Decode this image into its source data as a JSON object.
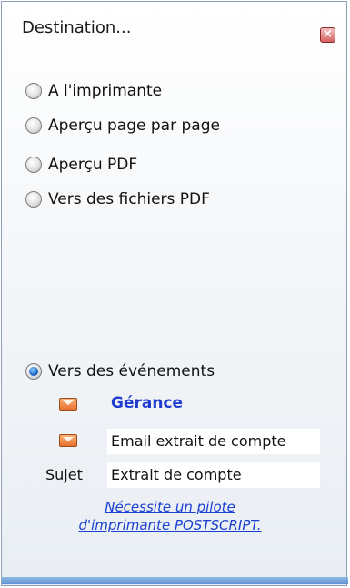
{
  "panel": {
    "title": "Destination...",
    "close_icon": "close-icon"
  },
  "options": [
    {
      "label": "A l'imprimante",
      "selected": false
    },
    {
      "label": "Aperçu page par page",
      "selected": false
    },
    {
      "label": "Aperçu PDF",
      "selected": false
    },
    {
      "label": "Vers des fichiers PDF",
      "selected": false
    },
    {
      "label": "Vers des événements",
      "selected": true
    }
  ],
  "events": {
    "recipient_label": "Gérance",
    "email_template": "Email extrait de compte",
    "subject_label": "Sujet",
    "subject_value": "Extrait de compte"
  },
  "note": {
    "line1": "Nécessite un pilote",
    "line2": "d'imprimante POSTSCRIPT."
  },
  "colors": {
    "link": "#1a3fd1",
    "recipient": "#1e3ccf",
    "selected_radio": "#1e66c8"
  }
}
